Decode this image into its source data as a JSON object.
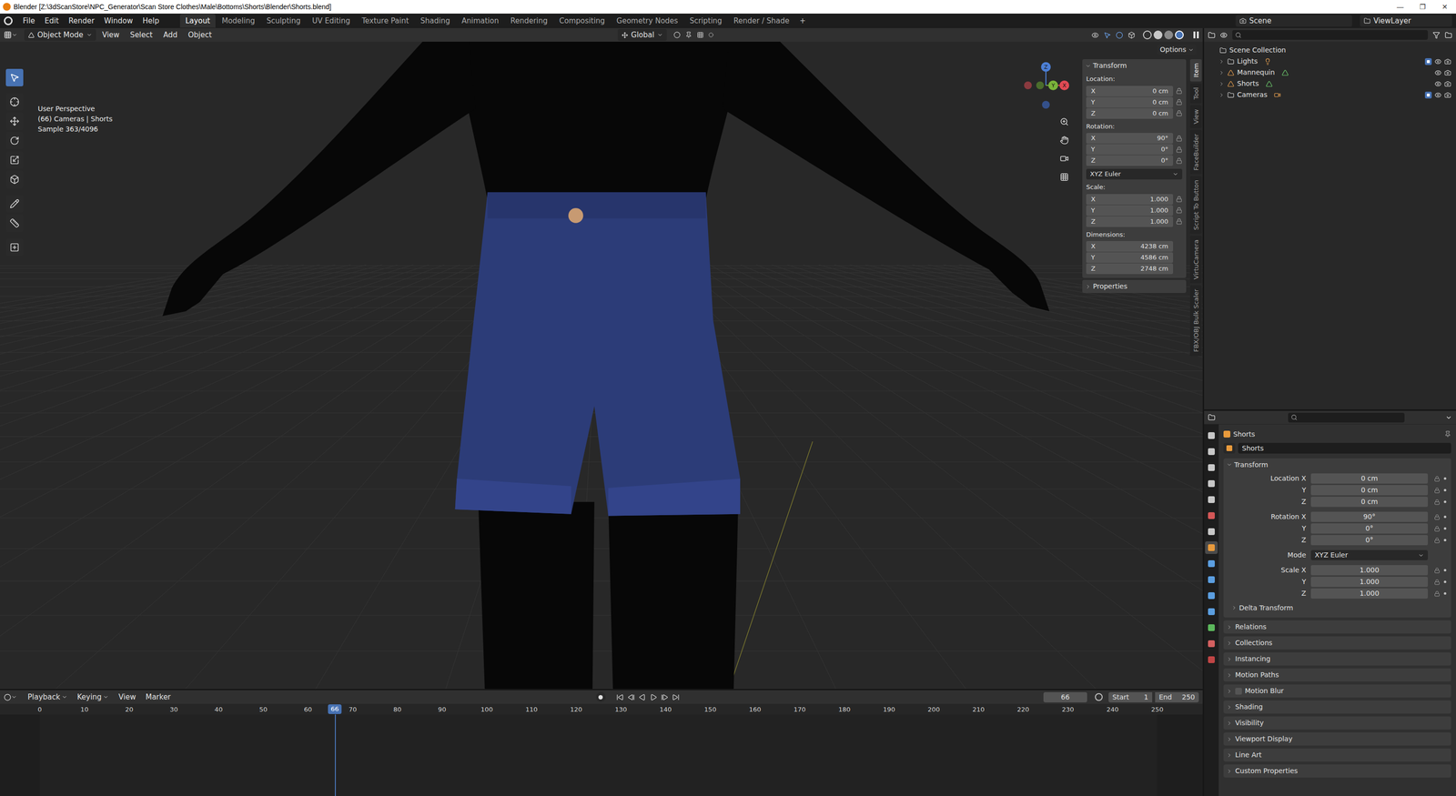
{
  "window": {
    "title": "Blender [Z:\\3dScanStore\\NPC_Generator\\Scan Store Clothes\\Male\\Bottoms\\Shorts\\Blender\\Shorts.blend]",
    "controls": [
      "—",
      "❐",
      "✕"
    ]
  },
  "menus": [
    "File",
    "Edit",
    "Render",
    "Window",
    "Help"
  ],
  "workspaces": [
    {
      "label": "Layout",
      "selected": true
    },
    {
      "label": "Modeling",
      "selected": false
    },
    {
      "label": "Sculpting",
      "selected": false
    },
    {
      "label": "UV Editing",
      "selected": false
    },
    {
      "label": "Texture Paint",
      "selected": false
    },
    {
      "label": "Shading",
      "selected": false
    },
    {
      "label": "Animation",
      "selected": false
    },
    {
      "label": "Rendering",
      "selected": false
    },
    {
      "label": "Compositing",
      "selected": false
    },
    {
      "label": "Geometry Nodes",
      "selected": false
    },
    {
      "label": "Scripting",
      "selected": false
    },
    {
      "label": "Render / Shade",
      "selected": false
    }
  ],
  "add_workspace": "+",
  "scene": "Scene",
  "view_layer": "ViewLayer",
  "viewport": {
    "header": {
      "mode": "Object Mode",
      "menus": [
        "View",
        "Select",
        "Add",
        "Object"
      ],
      "orientation": "Global",
      "options": "Options"
    },
    "overlay": [
      "User Perspective",
      "(66) Cameras | Shorts",
      "Sample 363/4096"
    ],
    "toolbar": [
      {
        "selected": true
      },
      {
        "selected": false
      },
      {
        "selected": false
      },
      {
        "selected": false
      },
      {
        "selected": false
      },
      {
        "selected": false
      },
      {
        "selected": false
      },
      {
        "selected": false
      },
      {
        "selected": false
      }
    ],
    "gizmo": {
      "x": "X",
      "y": "Y",
      "z": "Z"
    },
    "sidebar_tabs": [
      {
        "label": "Item",
        "selected": true
      },
      {
        "label": "Tool",
        "selected": false
      },
      {
        "label": "View",
        "selected": false
      },
      {
        "label": "FaceBuilder",
        "selected": false
      },
      {
        "label": "Script To Button",
        "selected": false
      },
      {
        "label": "VirtuCamera",
        "selected": false
      },
      {
        "label": "FBX/OBJ Bulk Scaler",
        "selected": false
      }
    ],
    "n_panel": {
      "title": "Transform",
      "expanded": true,
      "sections": [
        {
          "kind": "fields",
          "label": "Location:",
          "has_lock": true,
          "fields": [
            {
              "axis": "X",
              "value": "0 cm"
            },
            {
              "axis": "Y",
              "value": "0 cm"
            },
            {
              "axis": "Z",
              "value": "0 cm"
            }
          ]
        },
        {
          "kind": "fields",
          "label": "Rotation:",
          "has_lock": true,
          "fields": [
            {
              "axis": "X",
              "value": "90°"
            },
            {
              "axis": "Y",
              "value": "0°"
            },
            {
              "axis": "Z",
              "value": "0°"
            }
          ]
        },
        {
          "kind": "dropdown",
          "value": "XYZ Euler"
        },
        {
          "kind": "fields",
          "label": "Scale:",
          "has_lock": true,
          "fields": [
            {
              "axis": "X",
              "value": "1.000"
            },
            {
              "axis": "Y",
              "value": "1.000"
            },
            {
              "axis": "Z",
              "value": "1.000"
            }
          ]
        },
        {
          "kind": "fields",
          "label": "Dimensions:",
          "has_lock": false,
          "fields": [
            {
              "axis": "X",
              "value": "4238 cm"
            },
            {
              "axis": "Y",
              "value": "4586 cm"
            },
            {
              "axis": "Z",
              "value": "2748 cm"
            }
          ]
        }
      ],
      "collapsed": [
        {
          "label": "Properties",
          "expanded": false
        }
      ]
    }
  },
  "timeline": {
    "menus": [
      "Playback",
      "Keying",
      "View",
      "Marker"
    ],
    "current_frame": "66",
    "start_label": "Start",
    "start": "1",
    "end_label": "End",
    "end": "250",
    "ticks": [
      "0",
      "10",
      "20",
      "30",
      "40",
      "50",
      "60",
      "70",
      "80",
      "90",
      "100",
      "110",
      "120",
      "130",
      "140",
      "150",
      "160",
      "170",
      "180",
      "190",
      "200",
      "210",
      "220",
      "230",
      "240",
      "250"
    ]
  },
  "outliner": {
    "root": "Scene Collection",
    "root_expanded": true,
    "items": [
      {
        "name": "Lights",
        "kind": "collection",
        "expanded": false,
        "checked": true
      },
      {
        "name": "Mannequin",
        "kind": "object",
        "expanded": false
      },
      {
        "name": "Shorts",
        "kind": "object",
        "expanded": false
      },
      {
        "name": "Cameras",
        "kind": "collection",
        "expanded": false,
        "checked": true
      }
    ]
  },
  "properties": {
    "object_name": "Shorts",
    "data_name": "Shorts",
    "panel": "Transform",
    "panel_expanded": true,
    "tabs": [
      {
        "selected": false
      },
      {
        "selected": false
      },
      {
        "selected": false
      },
      {
        "selected": false
      },
      {
        "selected": false
      },
      {
        "selected": false
      },
      {
        "selected": false
      },
      {
        "selected": true
      },
      {
        "selected": false
      },
      {
        "selected": false
      },
      {
        "selected": false
      },
      {
        "selected": false
      },
      {
        "selected": false
      },
      {
        "selected": false
      },
      {
        "selected": false
      }
    ],
    "groups": [
      {
        "rows": [
          {
            "kind": "field",
            "label": "Location X",
            "value": "0 cm"
          },
          {
            "kind": "field",
            "label": "Y",
            "value": "0 cm"
          },
          {
            "kind": "field",
            "label": "Z",
            "value": "0 cm"
          }
        ]
      },
      {
        "rows": [
          {
            "kind": "field",
            "label": "Rotation X",
            "value": "90°"
          },
          {
            "kind": "field",
            "label": "Y",
            "value": "0°"
          },
          {
            "kind": "field",
            "label": "Z",
            "value": "0°"
          }
        ]
      },
      {
        "rows": [
          {
            "kind": "dropdown",
            "label": "Mode",
            "value": "XYZ Euler"
          }
        ]
      },
      {
        "rows": [
          {
            "kind": "field",
            "label": "Scale X",
            "value": "1.000"
          },
          {
            "kind": "field",
            "label": "Y",
            "value": "1.000"
          },
          {
            "kind": "field",
            "label": "Z",
            "value": "1.000"
          }
        ]
      }
    ],
    "subpanels": [
      {
        "label": "Delta Transform",
        "expanded": false
      }
    ],
    "panels": [
      {
        "label": "Relations",
        "checkbox": false
      },
      {
        "label": "Collections",
        "checkbox": false
      },
      {
        "label": "Instancing",
        "checkbox": false
      },
      {
        "label": "Motion Paths",
        "checkbox": false
      },
      {
        "label": "Motion Blur",
        "checkbox": true,
        "checked": false
      },
      {
        "label": "Shading",
        "checkbox": false
      },
      {
        "label": "Visibility",
        "checkbox": false
      },
      {
        "label": "Viewport Display",
        "checkbox": false
      },
      {
        "label": "Line Art",
        "checkbox": false
      },
      {
        "label": "Custom Properties",
        "checkbox": false
      }
    ]
  }
}
